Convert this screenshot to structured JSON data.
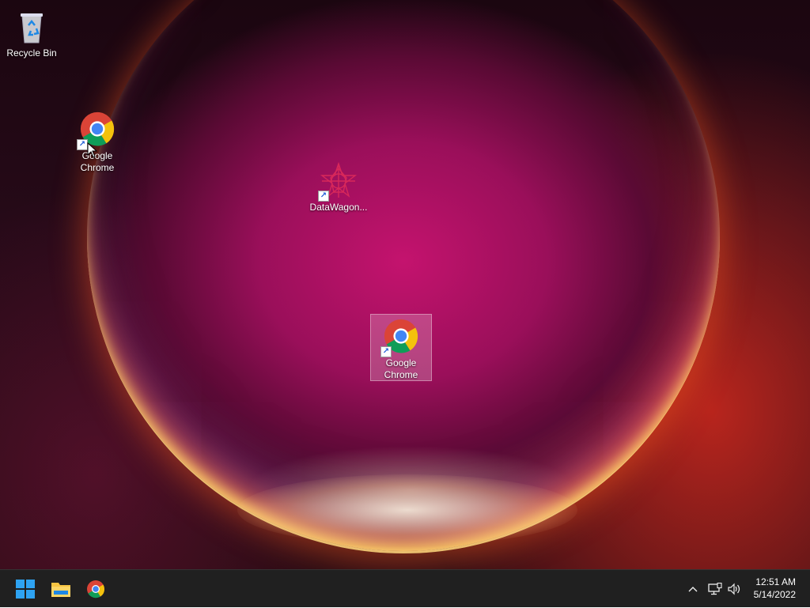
{
  "desktop": {
    "icons": [
      {
        "label": "Recycle Bin"
      },
      {
        "label": "Google\nChrome"
      },
      {
        "label": "DataWagon..."
      },
      {
        "label": "Google\nChrome"
      }
    ]
  },
  "taskbar": {
    "pinned": [
      "start-icon",
      "file-explorer-icon",
      "chrome-icon"
    ],
    "tray": [
      "chevron-up-icon",
      "network-icon",
      "volume-icon"
    ],
    "clock": {
      "time": "12:51 AM",
      "date": "5/14/2022"
    }
  },
  "colors": {
    "taskbar_bg": "#202020",
    "windows_blue": "#2ea3f2",
    "chrome_red": "#db4437",
    "chrome_yellow": "#f4c20d",
    "chrome_green": "#0f9d58",
    "chrome_blue": "#4285f4"
  }
}
